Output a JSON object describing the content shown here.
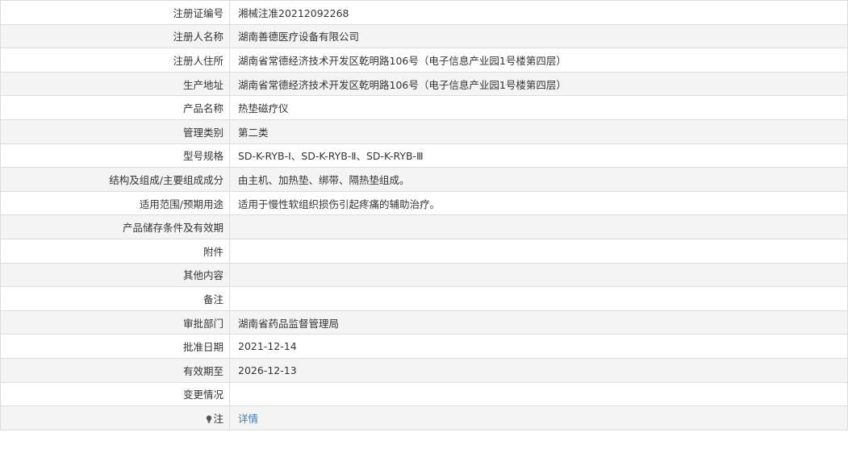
{
  "rows": [
    {
      "label": "注册证编号",
      "value": "湘械注准20212092268"
    },
    {
      "label": "注册人名称",
      "value": "湖南善德医疗设备有限公司"
    },
    {
      "label": "注册人住所",
      "value": "湖南省常德经济技术开发区乾明路106号（电子信息产业园1号楼第四层）"
    },
    {
      "label": "生产地址",
      "value": "湖南省常德经济技术开发区乾明路106号（电子信息产业园1号楼第四层）"
    },
    {
      "label": "产品名称",
      "value": "热垫磁疗仪"
    },
    {
      "label": "管理类别",
      "value": "第二类"
    },
    {
      "label": "型号规格",
      "value": "SD-K-RYB-Ⅰ、SD-K-RYB-Ⅱ、SD-K-RYB-Ⅲ"
    },
    {
      "label": "结构及组成/主要组成成分",
      "value": "由主机、加热垫、绑带、隔热垫组成。"
    },
    {
      "label": "适用范围/预期用途",
      "value": "适用于慢性软组织损伤引起疼痛的辅助治疗。"
    },
    {
      "label": "产品储存条件及有效期",
      "value": ""
    },
    {
      "label": "附件",
      "value": ""
    },
    {
      "label": "其他内容",
      "value": ""
    },
    {
      "label": "备注",
      "value": ""
    },
    {
      "label": "审批部门",
      "value": "湖南省药品监督管理局"
    },
    {
      "label": "批准日期",
      "value": "2021-12-14"
    },
    {
      "label": "有效期至",
      "value": "2026-12-13"
    },
    {
      "label": "变更情况",
      "value": ""
    }
  ],
  "note": {
    "label": "注",
    "icon": "lightbulb-icon",
    "link_text": "详情"
  },
  "colors": {
    "row_alt": "#f4f4f4",
    "border": "#dcdcdc",
    "link": "#3a7fc0"
  }
}
